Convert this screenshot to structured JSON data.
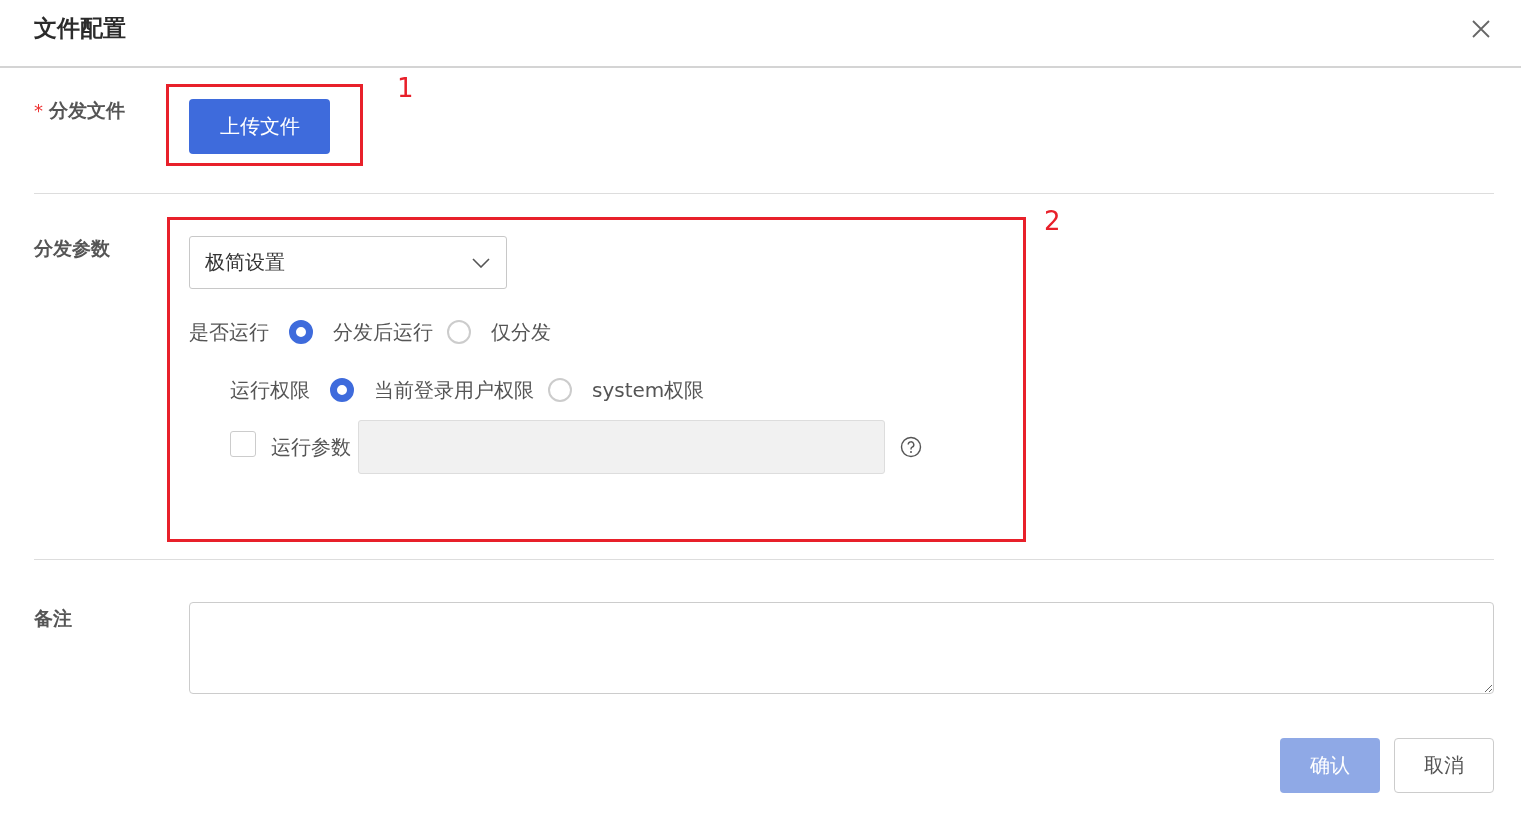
{
  "dialog": {
    "title": "文件配置"
  },
  "file": {
    "label": "分发文件",
    "required_mark": "*",
    "upload_button": "上传文件",
    "annotation": "1"
  },
  "params": {
    "label": "分发参数",
    "annotation": "2",
    "mode_select": {
      "value": "极简设置"
    },
    "run": {
      "label": "是否运行",
      "options": [
        {
          "label": "分发后运行",
          "selected": true
        },
        {
          "label": "仅分发",
          "selected": false
        }
      ]
    },
    "privilege": {
      "label": "运行权限",
      "options": [
        {
          "label": "当前登录用户权限",
          "selected": true
        },
        {
          "label": "system权限",
          "selected": false
        }
      ]
    },
    "run_args": {
      "label": "运行参数",
      "checked": false,
      "disabled": true
    }
  },
  "remark": {
    "label": "备注"
  },
  "buttons": [
    {
      "label": "确认",
      "kind": "primary",
      "disabled": true
    },
    {
      "label": "取消",
      "kind": "default",
      "disabled": false
    }
  ]
}
